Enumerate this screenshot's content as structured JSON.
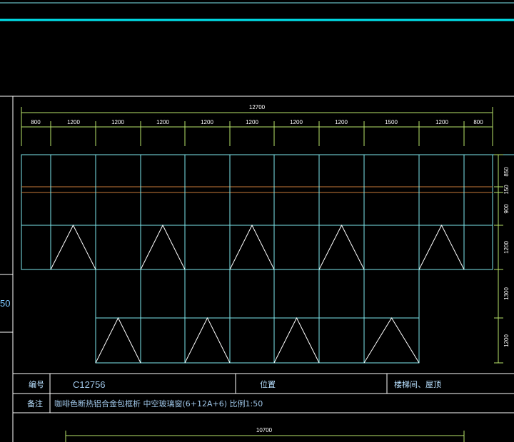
{
  "colors": {
    "background": "#000000",
    "frame": "#ffffff",
    "grid": "#7ee8ee",
    "accent_band": "#00e5f0",
    "dimension": "#b9e36a",
    "transom": "#c87a3a",
    "text": "#ffffff"
  },
  "drawing": {
    "total_width": "12700",
    "bay_widths": [
      "800",
      "1200",
      "1200",
      "1200",
      "1200",
      "1200",
      "1200",
      "1200",
      "1500",
      "1200",
      "800"
    ],
    "row_heights": [
      "850",
      "150",
      "900",
      "1200",
      "1300",
      "1200"
    ],
    "partial_left_label": "50",
    "bottom_dimension": "10700"
  },
  "title_block": {
    "code_label": "编号",
    "code_value": "C12756",
    "location_label": "位置",
    "location_value": "楼梯间、屋顶",
    "notes_label": "备注",
    "notes_value": "咖啡色断热铝合金包框析  中空玻璃窗(6+12A+6)    比例1:50"
  }
}
